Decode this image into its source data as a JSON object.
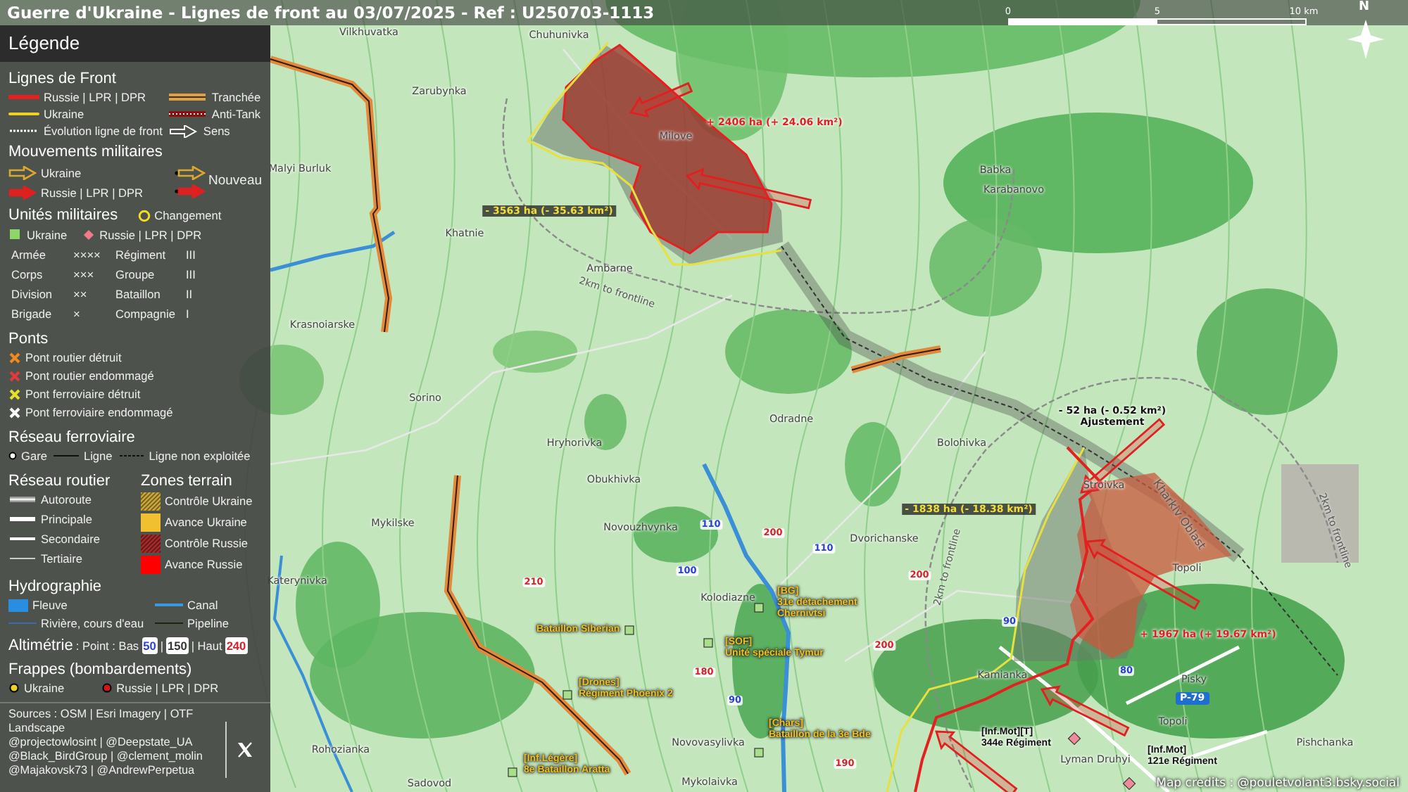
{
  "title": "Guerre d'Ukraine - Lignes de front au 03/07/2025 - Ref : U250703-1113",
  "scale": {
    "ticks": [
      "0",
      "5",
      "10 km"
    ]
  },
  "north": "N",
  "legend": {
    "title": "Légende",
    "front_lines": {
      "title": "Lignes de Front",
      "items": [
        {
          "kind": "russia",
          "label": "Russie | LPR | DPR"
        },
        {
          "kind": "trench",
          "label": "Tranchée"
        },
        {
          "kind": "ukraine",
          "label": "Ukraine"
        },
        {
          "kind": "antitank",
          "label": "Anti-Tank"
        },
        {
          "kind": "evolution",
          "label": "Évolution ligne de front"
        },
        {
          "kind": "direction",
          "label": "Sens"
        }
      ]
    },
    "movements": {
      "title": "Mouvements militaires",
      "new_label": "Nouveau",
      "items": [
        {
          "kind": "ukraine",
          "label": "Ukraine"
        },
        {
          "kind": "russia",
          "label": "Russie | LPR | DPR"
        }
      ]
    },
    "units": {
      "title": "Unités militaires",
      "change": "Changement",
      "sides": [
        {
          "kind": "ukraine",
          "label": "Ukraine"
        },
        {
          "kind": "russia",
          "label": "Russie | LPR | DPR"
        }
      ],
      "echelons": [
        {
          "name": "Armée",
          "symbol": "××××"
        },
        {
          "name": "Régiment",
          "symbol": "III"
        },
        {
          "name": "Corps",
          "symbol": "×××"
        },
        {
          "name": "Groupe",
          "symbol": "III"
        },
        {
          "name": "Division",
          "symbol": "××"
        },
        {
          "name": "Bataillon",
          "symbol": "II"
        },
        {
          "name": "Brigade",
          "symbol": "×"
        },
        {
          "name": "Compagnie",
          "symbol": "I"
        }
      ]
    },
    "bridges": {
      "title": "Ponts",
      "items": [
        {
          "label": "Pont routier détruit",
          "color": "#f08a1c"
        },
        {
          "label": "Pont routier endommagé",
          "color": "#e23a3a"
        },
        {
          "label": "Pont ferroviaire détruit",
          "color": "#e6e02a"
        },
        {
          "label": "Pont ferroviaire endommagé",
          "color": "#ffffff"
        }
      ]
    },
    "rail": {
      "title": "Réseau ferroviaire",
      "items": [
        {
          "kind": "station",
          "label": "Gare"
        },
        {
          "kind": "line",
          "label": "Ligne"
        },
        {
          "kind": "unused",
          "label": "Ligne non exploitée"
        }
      ]
    },
    "roads": {
      "title": "Réseau routier",
      "items": [
        {
          "kind": "motorway",
          "label": "Autoroute"
        },
        {
          "kind": "primary",
          "label": "Principale"
        },
        {
          "kind": "secondary",
          "label": "Secondaire"
        },
        {
          "kind": "tertiary",
          "label": "Tertiaire"
        }
      ]
    },
    "terrain": {
      "title": "Zones terrain",
      "items": [
        {
          "kind": "hatched",
          "color": "#c9a63a",
          "label": "Contrôle Ukraine"
        },
        {
          "kind": "solid",
          "color": "#f0c030",
          "label": "Avance Ukraine"
        },
        {
          "kind": "hatched",
          "color": "#a52a2a",
          "label": "Contrôle Russie"
        },
        {
          "kind": "solid",
          "color": "#ff0000",
          "label": "Avance Russie"
        }
      ]
    },
    "hydro": {
      "title": "Hydrographie",
      "items": [
        {
          "kind": "river",
          "label": "Fleuve"
        },
        {
          "kind": "canal",
          "label": "Canal"
        },
        {
          "kind": "stream",
          "label": "Rivière, cours d'eau"
        },
        {
          "kind": "pipeline",
          "label": "Pipeline"
        }
      ]
    },
    "altimetry": {
      "title": "Altimétrie",
      "prefix": ": Point : Bas",
      "low": "50",
      "separator": "|",
      "mid": "150",
      "high_prefix": "| Haut",
      "high": "240"
    },
    "strikes": {
      "title": "Frappes (bombardements)",
      "items": [
        {
          "label": "Ukraine",
          "color": "#f0d020"
        },
        {
          "label": "Russie | LPR | DPR",
          "color": "#d01818"
        }
      ]
    },
    "sources": [
      "Sources : OSM | Esri Imagery | OTF Landscape",
      "@projectowlosint | @Deepstate_UA",
      "@Black_BirdGroup | @clement_molin",
      "@Majakovsk73 | @AndrewPerpetua"
    ]
  },
  "map": {
    "places": [
      {
        "name": "Vilkhuvatka"
      },
      {
        "name": "Chuhunivka"
      },
      {
        "name": "Zarubynka"
      },
      {
        "name": "Malyi Burluk"
      },
      {
        "name": "Milove"
      },
      {
        "name": "Babka"
      },
      {
        "name": "Karabanovo"
      },
      {
        "name": "Khatnie"
      },
      {
        "name": "Ambarne"
      },
      {
        "name": "Krasnoiarske"
      },
      {
        "name": "Sorino"
      },
      {
        "name": "Odradne"
      },
      {
        "name": "Hryhorivka"
      },
      {
        "name": "Bolohivka"
      },
      {
        "name": "Stroivka"
      },
      {
        "name": "Obukhivka"
      },
      {
        "name": "Mykilske"
      },
      {
        "name": "Novouzhvynka"
      },
      {
        "name": "Dvorichanske"
      },
      {
        "name": "Topoli"
      },
      {
        "name": "Katerynivka"
      },
      {
        "name": "Kolodiazne"
      },
      {
        "name": "Kamianka"
      },
      {
        "name": "Pisky"
      },
      {
        "name": "Topoli"
      },
      {
        "name": "Novovasylivka"
      },
      {
        "name": "Pishchanka"
      },
      {
        "name": "Rohozianka"
      },
      {
        "name": "Lyman Druhyi"
      },
      {
        "name": "Mykolaivka"
      },
      {
        "name": "Sadovod"
      }
    ],
    "altitudes": [
      {
        "value": "110",
        "kind": "low"
      },
      {
        "value": "200",
        "kind": "high"
      },
      {
        "value": "110",
        "kind": "low"
      },
      {
        "value": "100",
        "kind": "low"
      },
      {
        "value": "210",
        "kind": "high"
      },
      {
        "value": "200",
        "kind": "high"
      },
      {
        "value": "200",
        "kind": "high"
      },
      {
        "value": "90",
        "kind": "low"
      },
      {
        "value": "80",
        "kind": "low"
      },
      {
        "value": "180",
        "kind": "high"
      },
      {
        "value": "90",
        "kind": "low"
      },
      {
        "value": "190",
        "kind": "high"
      }
    ],
    "areas": [
      {
        "kind": "gain",
        "lines": [
          "+ 2406 ha (+ 24.06 km²)"
        ]
      },
      {
        "kind": "loss",
        "lines": [
          "- 3563 ha (- 35.63 km²)"
        ]
      },
      {
        "kind": "adjust",
        "lines": [
          "- 52 ha (- 0.52 km²)",
          "Ajustement"
        ]
      },
      {
        "kind": "loss",
        "lines": [
          "- 1838 ha (- 18.38 km²)"
        ]
      },
      {
        "kind": "gain",
        "lines": [
          "+ 1967 ha (+ 19.67 km²)"
        ]
      }
    ],
    "units": [
      {
        "kind": "ukraine",
        "lines": [
          "[BG]",
          "31e détachement",
          "Chernivtsi"
        ]
      },
      {
        "kind": "ukraine",
        "lines": [
          "Bataillon Siberian"
        ]
      },
      {
        "kind": "ukraine",
        "lines": [
          "[SOF]",
          "Unité spéciale Tymur"
        ]
      },
      {
        "kind": "ukraine",
        "lines": [
          "[Drones]",
          "Régiment Phoenix 2"
        ]
      },
      {
        "kind": "ukraine",
        "lines": [
          "[Chars]",
          "Bataillon de la 3e Bde"
        ]
      },
      {
        "kind": "ukraine",
        "lines": [
          "[Inf.Légère]",
          "8e Bataillon Aratta"
        ]
      },
      {
        "kind": "russia",
        "lines": [
          "[Inf.Mot][T]",
          "344e Régiment"
        ]
      },
      {
        "kind": "russia",
        "lines": [
          "[Inf.Mot]",
          "121e Régiment"
        ]
      }
    ],
    "road_sign": "P-79",
    "rings": [
      "2km to frontline",
      "2km to frontline",
      "2km to frontline"
    ],
    "region": "Kharkiv Oblast",
    "credits": "Map credits : @pouletvolant3.bsky.social"
  }
}
